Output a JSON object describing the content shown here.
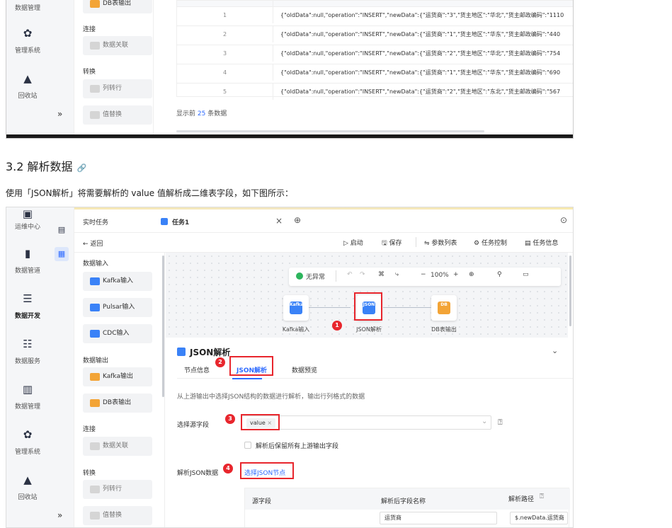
{
  "top_shot": {
    "sidebar": [
      {
        "label": "数据管理",
        "icon": "bar-chart-icon"
      },
      {
        "label": "管理系统",
        "icon": "gear-icon"
      },
      {
        "label": "回收站",
        "icon": "recycle-icon"
      }
    ],
    "palette": {
      "db_output": "DB表输出",
      "section_connect": "连接",
      "data_join": "数据关联",
      "section_transform": "转换",
      "row_to_col": "列转行",
      "value_replace": "值替换",
      "collapse": "»"
    },
    "table_rows": [
      {
        "n": "1",
        "v": "{\"oldData\":null,\"operation\":\"INSERT\",\"newData\":{\"运货商\":\"3\",\"货主地区\":\"华北\",\"货主邮政编码\":\"1110"
      },
      {
        "n": "2",
        "v": "{\"oldData\":null,\"operation\":\"INSERT\",\"newData\":{\"运货商\":\"1\",\"货主地区\":\"华东\",\"货主邮政编码\":\"440"
      },
      {
        "n": "3",
        "v": "{\"oldData\":null,\"operation\":\"INSERT\",\"newData\":{\"运货商\":\"2\",\"货主地区\":\"华北\",\"货主邮政编码\":\"754"
      },
      {
        "n": "4",
        "v": "{\"oldData\":null,\"operation\":\"INSERT\",\"newData\":{\"运货商\":\"1\",\"货主地区\":\"华东\",\"货主邮政编码\":\"690"
      },
      {
        "n": "5",
        "v": "{\"oldData\":null,\"operation\":\"INSERT\",\"newData\":{\"运货商\":\"2\",\"货主地区\":\"东北\",\"货主邮政编码\":\"567"
      }
    ],
    "show_prefix": "显示前",
    "show_count": "25",
    "show_suffix": "条数据"
  },
  "doc": {
    "heading": "3.2 解析数据",
    "link_icon": "🔗",
    "paragraph": "使用「JSON解析」将需要解析的 value 值解析成二维表字段，如下图所示："
  },
  "app": {
    "sidebar": [
      {
        "label": "运维中心",
        "icon": "monitor-icon"
      },
      {
        "label": "数据管道",
        "icon": "pipeline-icon"
      },
      {
        "label": "数据开发",
        "icon": "dev-icon",
        "active": true
      },
      {
        "label": "数据服务",
        "icon": "service-icon"
      },
      {
        "label": "数据管理",
        "icon": "bar-chart-icon"
      },
      {
        "label": "管理系统",
        "icon": "gear-icon"
      },
      {
        "label": "回收站",
        "icon": "recycle-icon"
      }
    ],
    "collapse": "»",
    "tabs": {
      "realtime": "实时任务",
      "task": "任务1",
      "close": "×",
      "add": "⊕",
      "more": "⊙"
    },
    "back": "← 返回",
    "actions": {
      "start": "启动",
      "save": "保存",
      "params": "参数列表",
      "control": "任务控制",
      "info": "任务信息"
    },
    "palette": {
      "input_section": "数据输入",
      "kafka_in": "Kafka输入",
      "pulsar_in": "Pulsar输入",
      "cdc_in": "CDC输入",
      "output_section": "数据输出",
      "kafka_out": "Kafka输出",
      "db_out": "DB表输出",
      "connect_section": "连接",
      "join": "数据关联",
      "transform_section": "转换",
      "row_col": "列转行",
      "replace": "值替换"
    },
    "canvas": {
      "status": "无异常",
      "zoom": "100%",
      "nodes": {
        "kafka": "Kafka输入",
        "json": "JSON解析",
        "db": "DB表输出"
      },
      "kafka_glyph": "Kafka",
      "json_glyph": "JSON",
      "db_glyph": "DB"
    },
    "panel": {
      "title": "JSON解析",
      "tabs": {
        "node_info": "节点信息",
        "json": "JSON解析",
        "preview": "数据预览"
      },
      "desc": "从上游输出中选择JSON结构的数据进行解析，输出行列格式的数据",
      "select_label": "选择源字段",
      "tag": "value",
      "tag_close": "×",
      "keep_label": "解析后保留所有上游输出字段",
      "parse_label": "解析JSON数据",
      "choose_node": "选择JSON节点",
      "cols": {
        "src": "源字段",
        "name": "解析后字段名称",
        "path": "解析路径"
      },
      "row1_name": "运货商",
      "row1_path": "$.newData.运货商"
    },
    "badges": [
      "1",
      "2",
      "3",
      "4"
    ],
    "accent": "#2f6bff",
    "highlight": "#e8262d"
  }
}
